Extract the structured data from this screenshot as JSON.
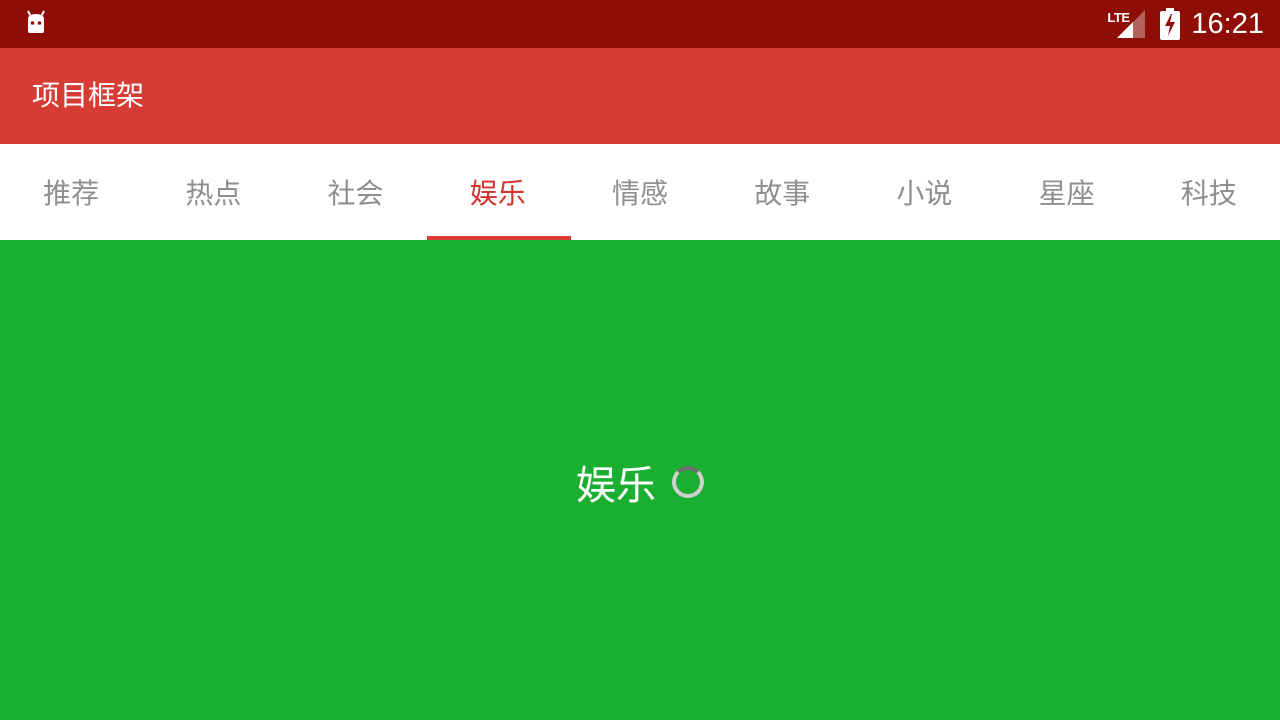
{
  "status_bar": {
    "network_label": "LTE",
    "time": "16:21",
    "icons": [
      "android-notification-icon",
      "signal-icon",
      "battery-charging-icon"
    ]
  },
  "app_bar": {
    "title": "项目框架"
  },
  "tabs": [
    {
      "label": "推荐",
      "active": false
    },
    {
      "label": "热点",
      "active": false
    },
    {
      "label": "社会",
      "active": false
    },
    {
      "label": "娱乐",
      "active": true
    },
    {
      "label": "情感",
      "active": false
    },
    {
      "label": "故事",
      "active": false
    },
    {
      "label": "小说",
      "active": false
    },
    {
      "label": "星座",
      "active": false
    },
    {
      "label": "科技",
      "active": false
    }
  ],
  "content": {
    "loading_text": "娱乐"
  },
  "colors": {
    "status_bar": "#8e0d05",
    "app_bar": "#d73c34",
    "active_tab": "#d3322d",
    "inactive_tab": "#8f8f8f",
    "content_background": "#1aaf31"
  }
}
